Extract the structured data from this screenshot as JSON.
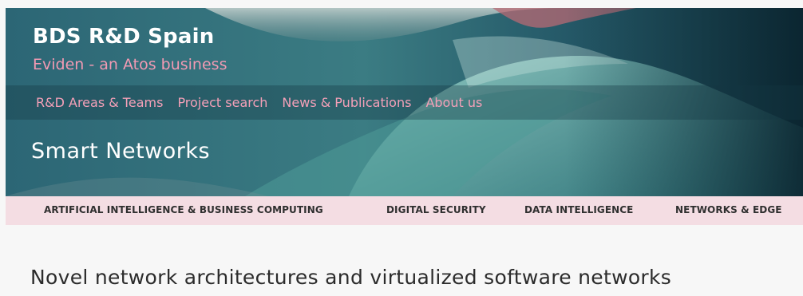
{
  "site": {
    "title": "BDS R&D Spain",
    "subtitle": "Eviden - an Atos business"
  },
  "main_nav": {
    "items": [
      {
        "label": "R&D Areas & Teams"
      },
      {
        "label": "Project search"
      },
      {
        "label": "News & Publications"
      },
      {
        "label": "About us"
      }
    ]
  },
  "hero": {
    "section_title": "Smart Networks"
  },
  "sub_nav": {
    "items": [
      {
        "label": "ARTIFICIAL INTELLIGENCE & BUSINESS COMPUTING"
      },
      {
        "label": "DIGITAL SECURITY"
      },
      {
        "label": "DATA INTELLIGENCE"
      },
      {
        "label": "NETWORKS & EDGE"
      }
    ]
  },
  "content": {
    "heading": "Novel network architectures and virtualized software networks"
  },
  "colors": {
    "accent_pink": "#f4a0b8",
    "sub_nav_bg": "#f4dde3",
    "hero_teal": "#2a6472"
  }
}
